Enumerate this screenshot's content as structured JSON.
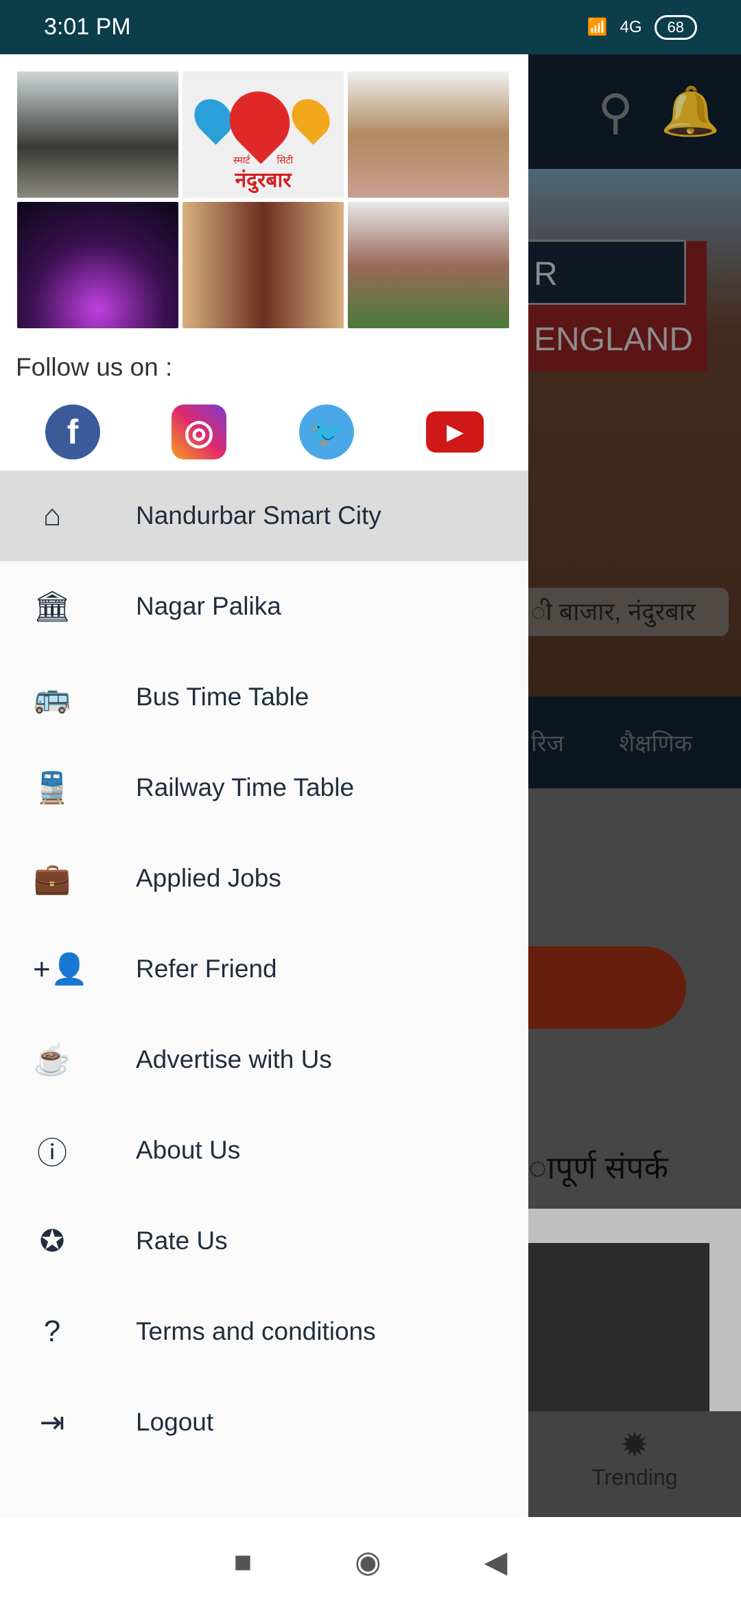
{
  "status": {
    "time": "3:01 PM",
    "network": "4G",
    "battery": "68"
  },
  "background": {
    "banner_text": "R ENGLAND",
    "caption": "ी बाजार, नंदुरबार",
    "tabs": [
      "रिज",
      "शैक्षणिक"
    ],
    "card_title": "ापूर्ण संपर्क",
    "bottom_nav_label": "Trending"
  },
  "drawer": {
    "logo_text": "नंदुरबार",
    "logo_sub_left": "स्मार्ट",
    "logo_sub_right": "सिटी",
    "follow_label": "Follow us on :",
    "social": [
      "facebook",
      "instagram",
      "twitter",
      "youtube"
    ],
    "items": [
      {
        "label": "Nandurbar Smart City",
        "icon": "home-icon"
      },
      {
        "label": "Nagar Palika",
        "icon": "bank-icon"
      },
      {
        "label": "Bus Time Table",
        "icon": "bus-icon"
      },
      {
        "label": "Railway Time Table",
        "icon": "train-icon"
      },
      {
        "label": "Applied Jobs",
        "icon": "briefcase-icon"
      },
      {
        "label": "Refer Friend",
        "icon": "add-person-icon"
      },
      {
        "label": "Advertise with Us",
        "icon": "cup-icon"
      },
      {
        "label": "About Us",
        "icon": "info-icon"
      },
      {
        "label": "Rate Us",
        "icon": "star-icon"
      },
      {
        "label": "Terms and conditions",
        "icon": "help-icon"
      },
      {
        "label": "Logout",
        "icon": "logout-icon"
      }
    ]
  },
  "colors": {
    "status_bar": "#0b3d4a",
    "active_item": "#dcdcdc",
    "text": "#1f2d3d"
  }
}
